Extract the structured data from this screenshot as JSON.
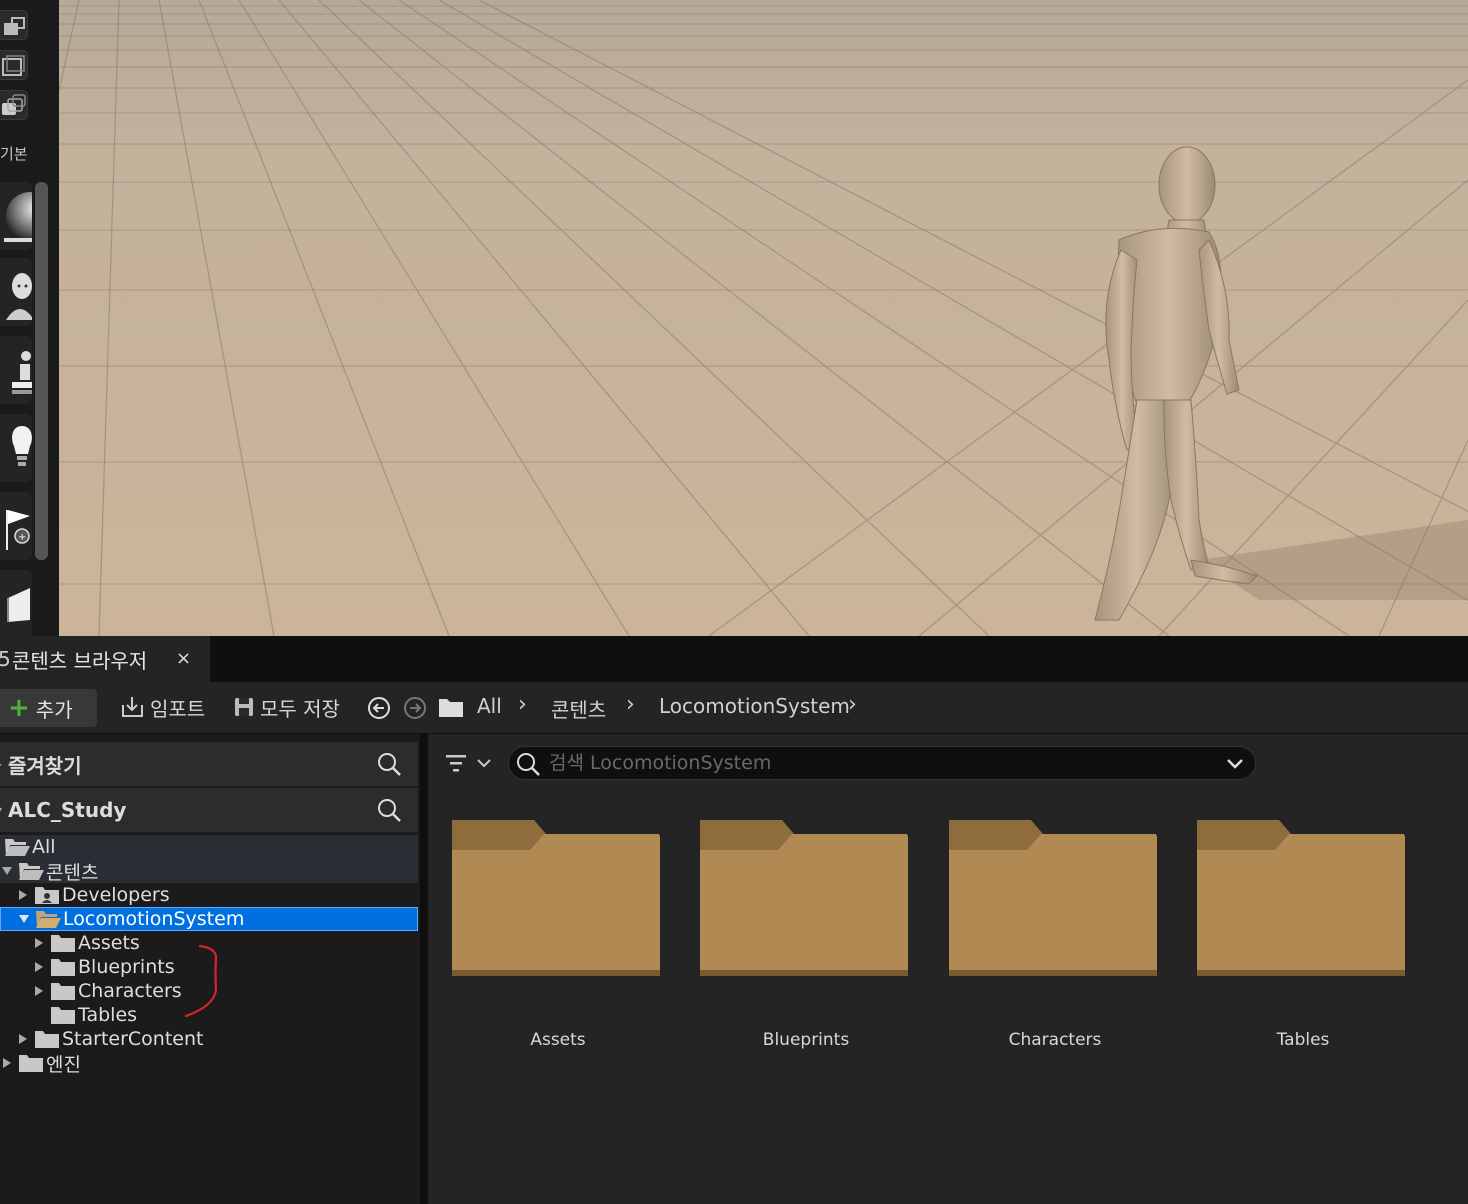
{
  "left_toolbar": {
    "label": "기본",
    "buttons": [
      "place-actor-cube-icon",
      "place-actor-plane-icon",
      "place-actor-stack-icon"
    ],
    "assets": [
      "sphere-icon",
      "character-icon",
      "pawn-icon",
      "light-bulb-icon",
      "player-start-flag-icon",
      "volume-icon"
    ]
  },
  "content_browser": {
    "tab": {
      "glyph": "5",
      "title": "콘텐츠 브라우저",
      "close": "×"
    },
    "toolbar": {
      "add_label": "추가",
      "import_label": "임포트",
      "save_all_label": "모두 저장",
      "breadcrumb": [
        "All",
        "콘텐츠",
        "LocomotionSystem"
      ]
    },
    "favorites": {
      "title": "즐겨찾기"
    },
    "project": {
      "title": "ALC_Study"
    },
    "tree": [
      {
        "label": "All"
      },
      {
        "label": "콘텐츠"
      },
      {
        "label": "Developers"
      },
      {
        "label": "LocomotionSystem",
        "selected": true
      },
      {
        "label": "Assets"
      },
      {
        "label": "Blueprints"
      },
      {
        "label": "Characters"
      },
      {
        "label": "Tables"
      },
      {
        "label": "StarterContent"
      },
      {
        "label": "엔진"
      }
    ],
    "search": {
      "placeholder": "검색 LocomotionSystem",
      "value": ""
    },
    "folders": [
      {
        "label": "Assets"
      },
      {
        "label": "Blueprints"
      },
      {
        "label": "Characters"
      },
      {
        "label": "Tables"
      }
    ],
    "colors": {
      "selection": "#0070e0",
      "folder": "#b08a52",
      "add_plus": "#4fb33b",
      "annotation": "#d8232a"
    }
  }
}
